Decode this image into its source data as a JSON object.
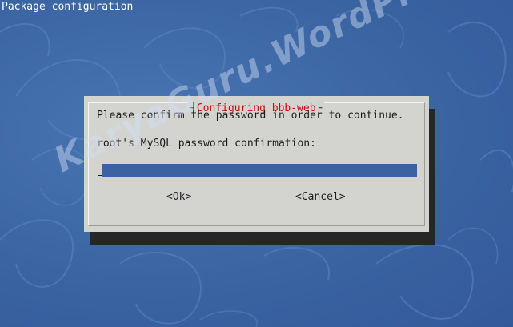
{
  "window": {
    "title": "Package configuration"
  },
  "dialog": {
    "title": "Configuring bbb-web",
    "title_left_bracket": "┤",
    "title_right_bracket": "├",
    "message": "Please confirm the password in order to continue.",
    "field_label": "root's MySQL password confirmation:",
    "password_value": "",
    "buttons": {
      "ok": "<Ok>",
      "cancel": "<Cancel>"
    }
  },
  "watermark": {
    "text": "KaryaGuru.WordPress.Com"
  },
  "colors": {
    "background": "#3f6aa8",
    "dialog_bg": "#d3d3cf",
    "dialog_title": "#c01010",
    "input_bg": "#3a63a3",
    "shadow": "#262626"
  }
}
